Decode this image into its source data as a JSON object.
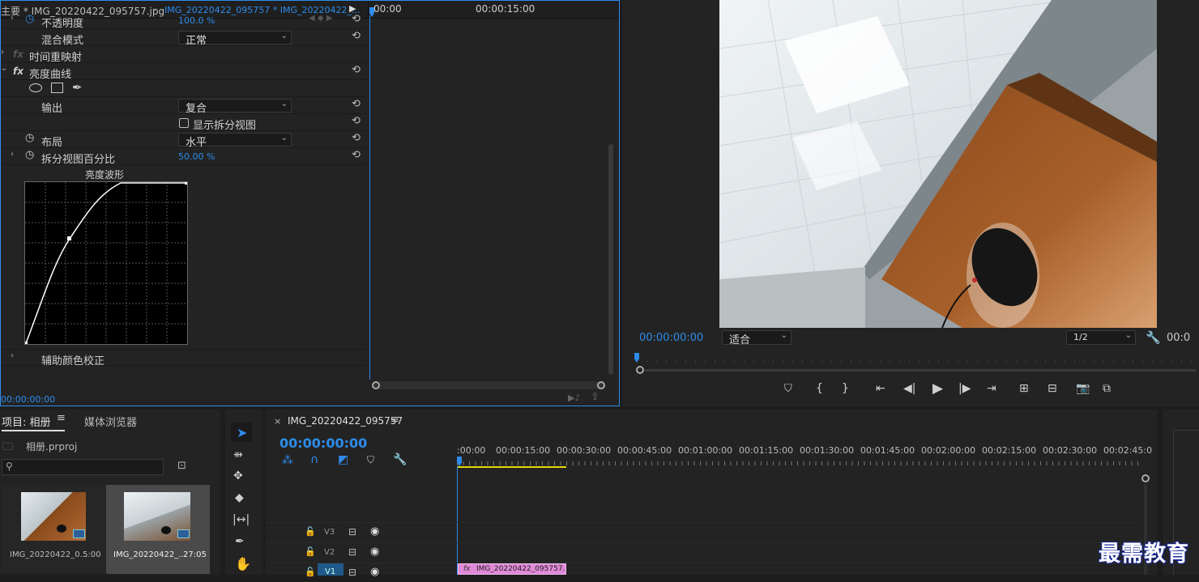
{
  "effect_controls": {
    "tab_main": "主要 * IMG_20220422_095757.jpg",
    "tab_clip": "IMG_20220422_095757 * IMG_20220422_...",
    "ruler_start": "00:00",
    "ruler_mid": "00:00:15:00",
    "opacity_label": "不透明度",
    "opacity_value": "100.0 %",
    "blend_label": "混合模式",
    "blend_value": "正常",
    "time_remap_label": "时间重映射",
    "luma_curve_label": "亮度曲线",
    "output_label": "输出",
    "output_value": "复合",
    "split_view_label": "显示拆分视图",
    "layout_label": "布局",
    "layout_value": "水平",
    "split_percent_label": "拆分视图百分比",
    "split_percent_value": "50.00 %",
    "waveform_label": "亮度波形",
    "secondary_label": "辅助颜色校正",
    "timecode": "00:00:00:00",
    "fx": "fx"
  },
  "program_monitor": {
    "timecode": "00:00:00:00",
    "fit_value": "适合",
    "resolution_value": "1/2",
    "duration": "00:0"
  },
  "project": {
    "tab_project": "项目: 相册",
    "tab_media": "媒体浏览器",
    "file": "相册.prproj",
    "items": [
      {
        "name": "IMG_20220422_0...",
        "duration": "5:00"
      },
      {
        "name": "IMG_20220422_...",
        "duration": "27:05"
      }
    ]
  },
  "timeline": {
    "sequence_name": "IMG_20220422_095757",
    "timecode": "00:00:00:00",
    "ticks": [
      ":00:00",
      "00:00:15:00",
      "00:00:30:00",
      "00:00:45:00",
      "00:01:00:00",
      "00:01:15:00",
      "00:01:30:00",
      "00:01:45:00",
      "00:02:00:00",
      "00:02:15:00",
      "00:02:30:00",
      "00:02:45:0"
    ],
    "tracks": [
      "V3",
      "V2",
      "V1"
    ],
    "clip_label": "IMG_20220422_095757."
  },
  "watermark": "最需教育",
  "colors": {
    "accent": "#2d8ceb",
    "clip": "#e08ad8",
    "in_out": "#e8d800"
  }
}
